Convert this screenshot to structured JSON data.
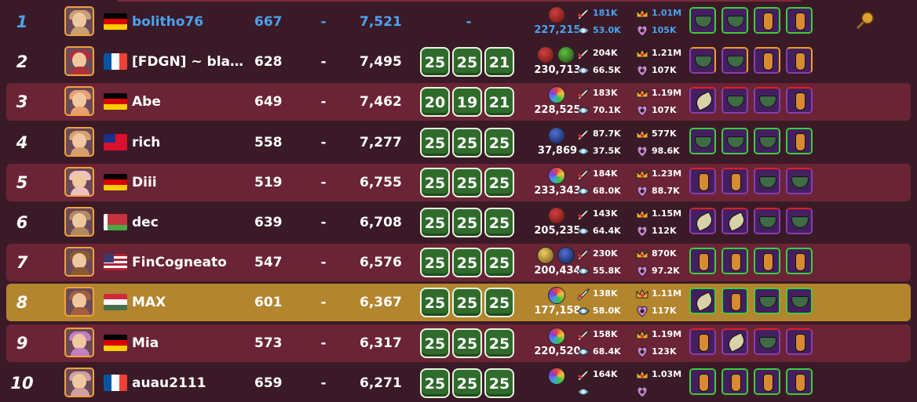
{
  "rows": [
    {
      "rank": "1",
      "name": "bolitho76",
      "level": "667",
      "mid": "-",
      "score": "7,521",
      "tiles": [],
      "center": "-",
      "orbs": [
        "red"
      ],
      "power": "227,215",
      "atk": "181K",
      "def": "53.0K",
      "hp": "1.01M",
      "ego": "105K",
      "items": [
        "bowl:g",
        "bowl:g",
        "bottle:g",
        "bottle:g"
      ],
      "self": false,
      "highlight": "blue",
      "stripe": false,
      "flag": "de",
      "avatar": "#c9a070",
      "pin": true
    },
    {
      "rank": "2",
      "name": "[FDGN] ~ bla…",
      "level": "628",
      "mid": "-",
      "score": "7,495",
      "tiles": [
        "25",
        "25",
        "21"
      ],
      "center": "",
      "orbs": [
        "red",
        "green"
      ],
      "power": "230,713",
      "atk": "204K",
      "def": "66.5K",
      "hp": "1.21M",
      "ego": "107K",
      "items": [
        "bowl:o",
        "bowl:o",
        "bottle:o",
        "bottle:o"
      ],
      "self": false,
      "highlight": "",
      "stripe": false,
      "flag": "fr",
      "avatar": "#b0303a",
      "pin": false
    },
    {
      "rank": "3",
      "name": "Abe",
      "level": "649",
      "mid": "-",
      "score": "7,462",
      "tiles": [
        "20",
        "19",
        "21"
      ],
      "center": "",
      "orbs": [
        "rainbow"
      ],
      "power": "228,525",
      "atk": "183K",
      "def": "70.1K",
      "hp": "1.19M",
      "ego": "107K",
      "items": [
        "leaf:r",
        "bowl:r",
        "bowl:r",
        "bottle:r"
      ],
      "self": false,
      "highlight": "",
      "stripe": true,
      "flag": "de",
      "avatar": "#e8a070",
      "pin": false
    },
    {
      "rank": "4",
      "name": "rich",
      "level": "558",
      "mid": "-",
      "score": "7,277",
      "tiles": [
        "25",
        "25",
        "25"
      ],
      "center": "",
      "orbs": [
        "blue"
      ],
      "power": "37,869",
      "atk": "87.7K",
      "def": "37.5K",
      "hp": "577K",
      "ego": "98.6K",
      "items": [
        "bowl:g",
        "bowl:g",
        "bowl:g",
        "bottle:g"
      ],
      "self": false,
      "highlight": "",
      "stripe": false,
      "flag": "tw",
      "avatar": "#d8a070",
      "pin": false
    },
    {
      "rank": "5",
      "name": "Diii",
      "level": "519",
      "mid": "-",
      "score": "6,755",
      "tiles": [
        "25",
        "25",
        "25"
      ],
      "center": "",
      "orbs": [
        "rainbow"
      ],
      "power": "233,343",
      "atk": "184K",
      "def": "68.0K",
      "hp": "1.23M",
      "ego": "88.7K",
      "items": [
        "bottle:r",
        "bottle:r",
        "bowl:r",
        "bowl:r"
      ],
      "self": false,
      "highlight": "",
      "stripe": true,
      "flag": "de",
      "avatar": "#f0c0c0",
      "pin": false
    },
    {
      "rank": "6",
      "name": "dec",
      "level": "639",
      "mid": "-",
      "score": "6,708",
      "tiles": [
        "25",
        "25",
        "25"
      ],
      "center": "",
      "orbs": [
        "red"
      ],
      "power": "205,235",
      "atk": "143K",
      "def": "64.4K",
      "hp": "1.15M",
      "ego": "112K",
      "items": [
        "leaf:r",
        "leaf:r",
        "bowl:r",
        "bowl:r"
      ],
      "self": false,
      "highlight": "",
      "stripe": false,
      "flag": "by",
      "avatar": "#b08a60",
      "pin": false
    },
    {
      "rank": "7",
      "name": "FinCogneato",
      "level": "547",
      "mid": "-",
      "score": "6,576",
      "tiles": [
        "25",
        "25",
        "25"
      ],
      "center": "",
      "orbs": [
        "gold",
        "blue"
      ],
      "power": "200,434",
      "atk": "230K",
      "def": "55.8K",
      "hp": "870K",
      "ego": "97.2K",
      "items": [
        "bottle:g",
        "bottle:g",
        "bottle:g",
        "bottle:g"
      ],
      "self": false,
      "highlight": "",
      "stripe": true,
      "flag": "us",
      "avatar": "#8a5a30",
      "pin": false
    },
    {
      "rank": "8",
      "name": "MAX",
      "level": "601",
      "mid": "-",
      "score": "6,367",
      "tiles": [
        "25",
        "25",
        "25"
      ],
      "center": "",
      "orbs": [
        "rainbow"
      ],
      "power": "177,158",
      "atk": "138K",
      "def": "58.0K",
      "hp": "1.11M",
      "ego": "117K",
      "items": [
        "leaf:g",
        "bottle:g",
        "bowl:g",
        "bowl:g"
      ],
      "self": true,
      "highlight": "",
      "stripe": false,
      "flag": "hu",
      "avatar": "#a06040",
      "pin": false
    },
    {
      "rank": "9",
      "name": "Mia",
      "level": "573",
      "mid": "-",
      "score": "6,317",
      "tiles": [
        "25",
        "25",
        "25"
      ],
      "center": "",
      "orbs": [
        "rainbow"
      ],
      "power": "220,520",
      "atk": "158K",
      "def": "68.4K",
      "hp": "1.19M",
      "ego": "123K",
      "items": [
        "bottle:r",
        "leaf:r",
        "bowl:r",
        "bottle:r"
      ],
      "self": false,
      "highlight": "",
      "stripe": true,
      "flag": "de",
      "avatar": "#c080c0",
      "pin": false
    },
    {
      "rank": "10",
      "name": "auau2111",
      "level": "659",
      "mid": "-",
      "score": "6,271",
      "tiles": [
        "25",
        "25",
        "25"
      ],
      "center": "",
      "orbs": [
        "rainbow"
      ],
      "power": "",
      "atk": "164K",
      "def": "",
      "hp": "1.03M",
      "ego": "",
      "items": [
        "bottle:g",
        "bottle:g",
        "bottle:g",
        "bottle:g"
      ],
      "self": false,
      "highlight": "",
      "stripe": false,
      "flag": "fr",
      "avatar": "#d0a0a0",
      "pin": false
    }
  ],
  "icons": {
    "attack": "attack-icon",
    "defense": "defense-icon",
    "health": "crown-health-icon",
    "ego": "ego-icon",
    "pin": "pin-icon"
  },
  "colors": {
    "row_stripe": "#6a2436",
    "row_self": "#b3852e",
    "row_base": "#3b1a28",
    "tile_green": "#2f6b2a",
    "blue_text": "#4aa3f0"
  }
}
